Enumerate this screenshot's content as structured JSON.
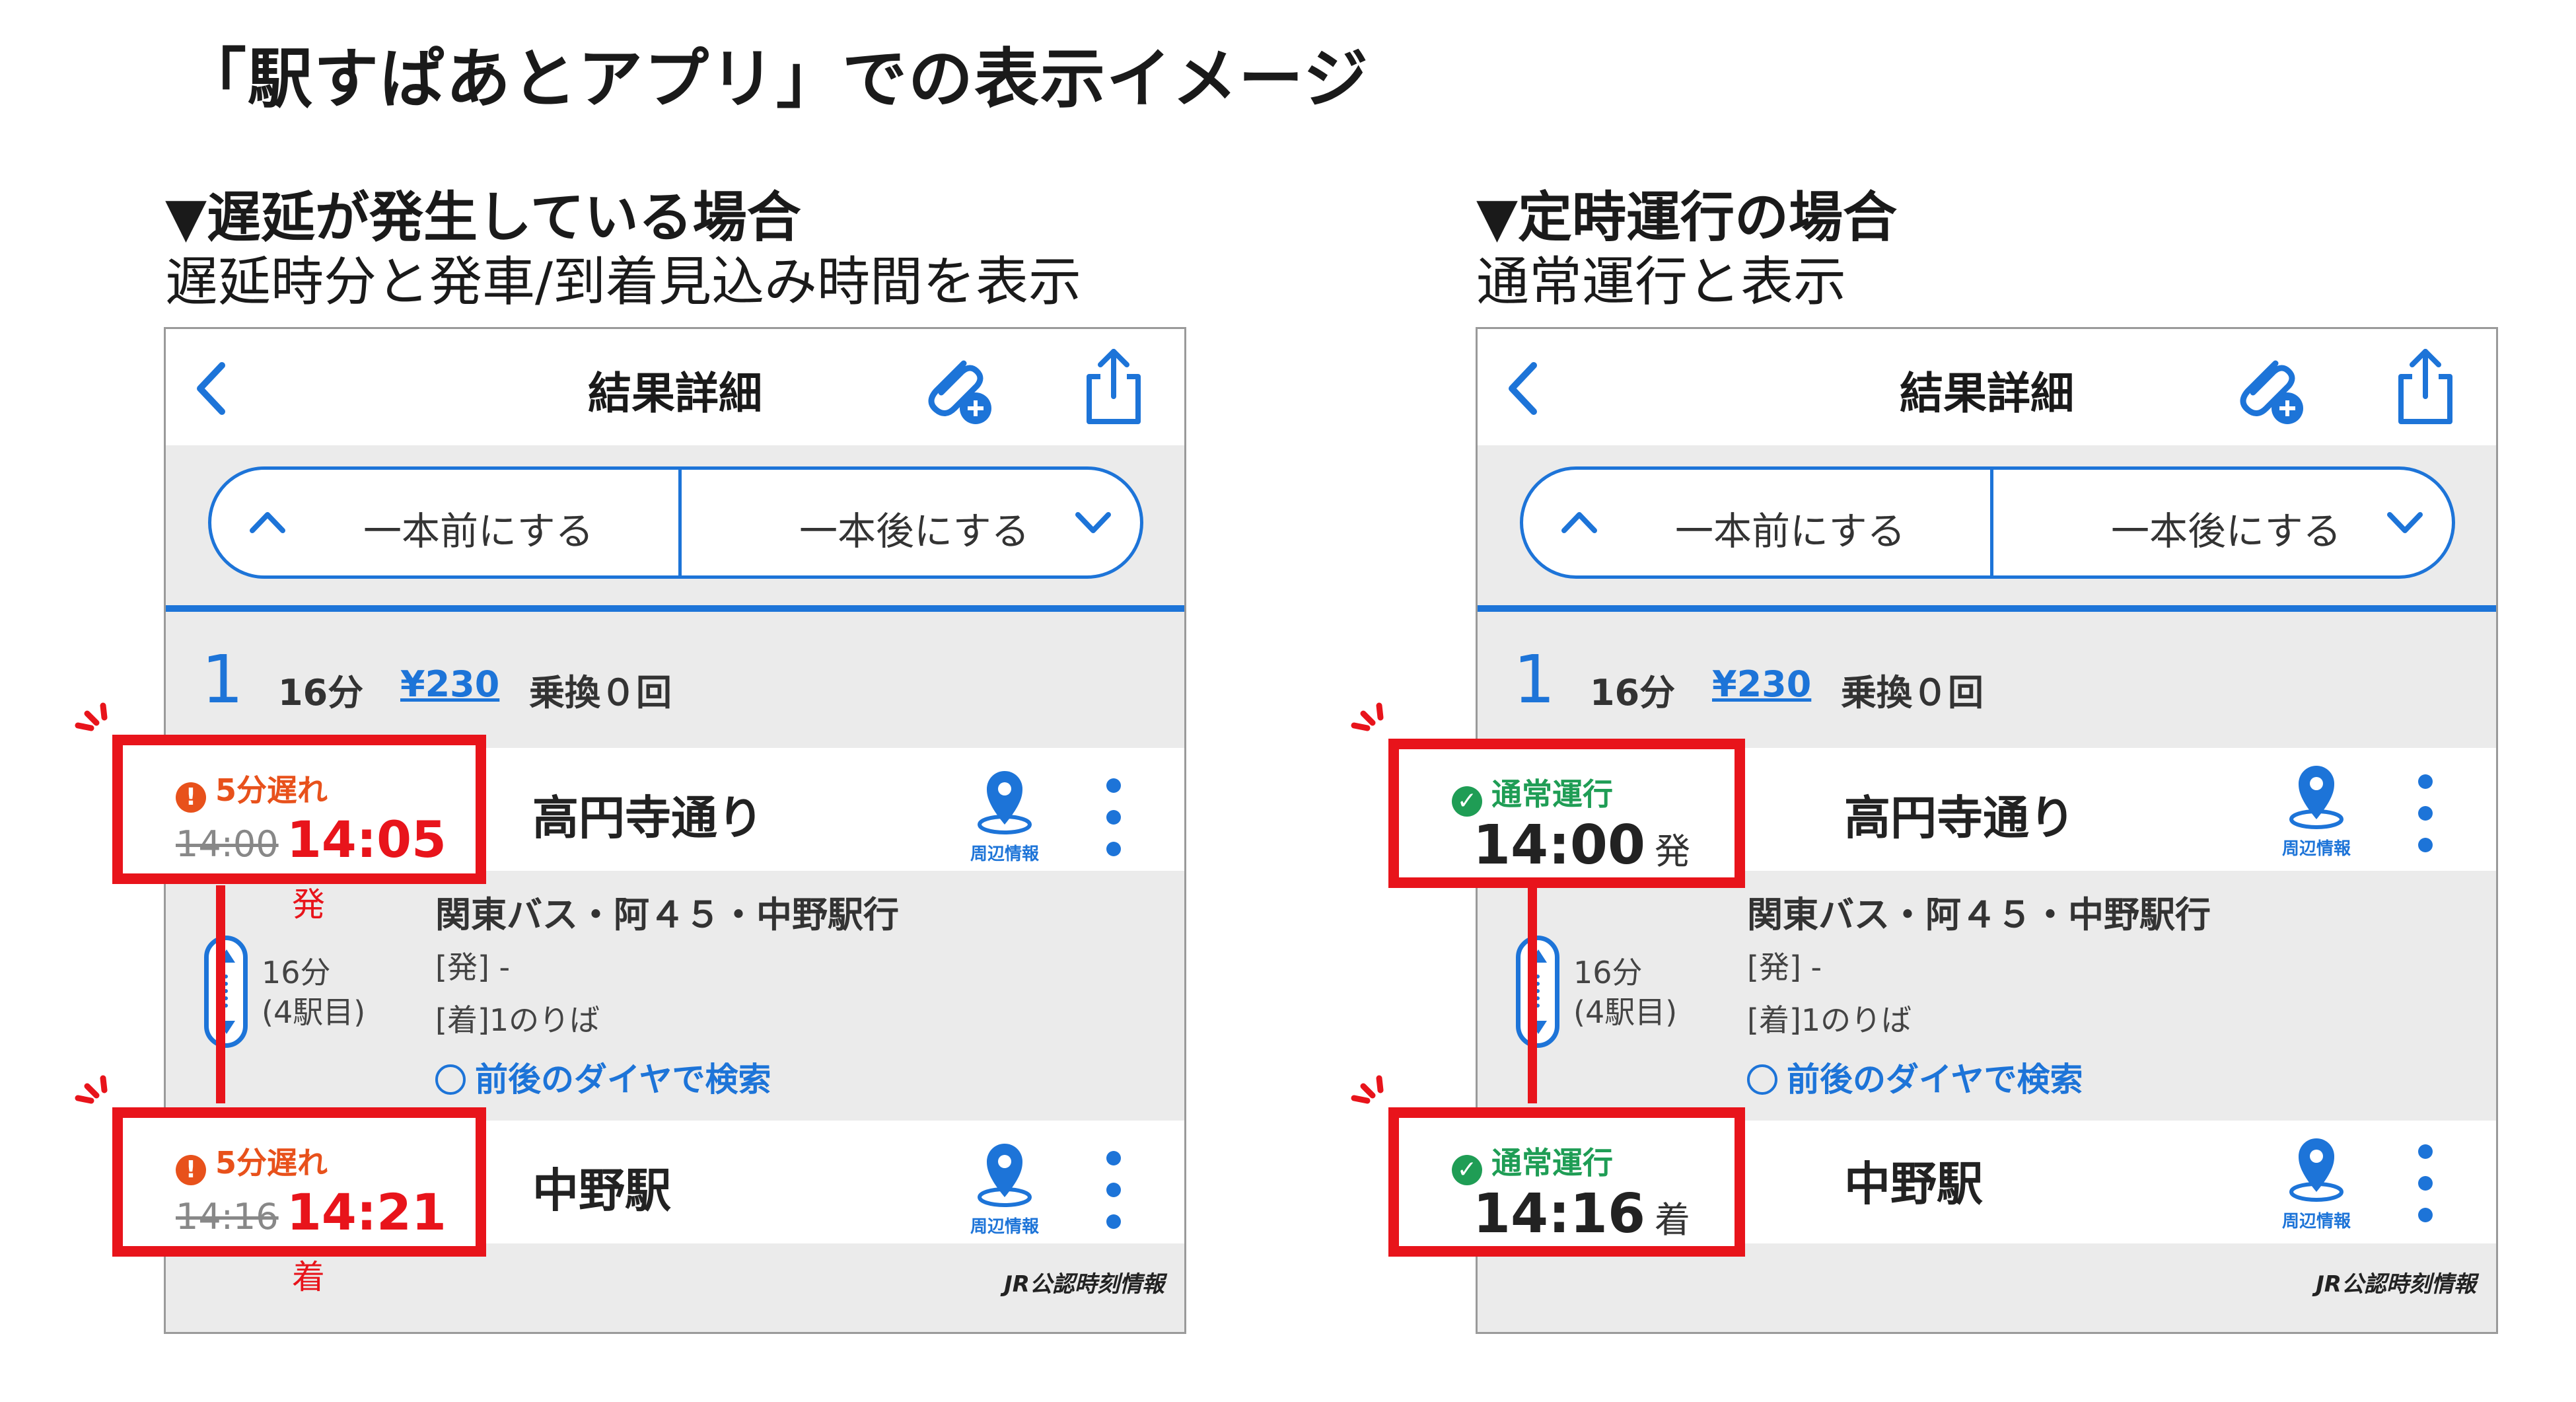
{
  "page_title": "「駅すぱあとアプリ」での表示イメージ",
  "sections": {
    "delay": {
      "heading": "▼遅延が発生している場合",
      "subheading": "遅延時分と発車/到着見込み時間を表示"
    },
    "normal": {
      "heading": "▼定時運行の場合",
      "subheading": "通常運行と表示"
    }
  },
  "screen": {
    "title": "結果詳細",
    "prev_label": "一本前にする",
    "next_label": "一本後にする",
    "route_index": "1",
    "duration": "16分",
    "fare": "¥230",
    "transfers": "乗換０回",
    "departure_station": "高円寺通り",
    "arrival_station": "中野駅",
    "area_info": "周辺情報",
    "line_name": "関東バス・阿４５・中野駅行",
    "dep_note": "[発] -",
    "arr_note": "[着]1のりば",
    "ride_duration": "16分",
    "ride_stops": "(4駅目)",
    "search_link": "前後のダイヤで検索",
    "brand": "JR公認時刻情報"
  },
  "delay_case": {
    "dep_status": "5分遅れ",
    "dep_scheduled": "14:00",
    "dep_expected": "14:05",
    "dep_suffix": "発",
    "arr_status": "5分遅れ",
    "arr_scheduled": "14:16",
    "arr_expected": "14:21",
    "arr_suffix": "着"
  },
  "normal_case": {
    "dep_status": "通常運行",
    "dep_time": "14:00",
    "dep_suffix": "発",
    "arr_status": "通常運行",
    "arr_time": "14:16",
    "arr_suffix": "着"
  },
  "colors": {
    "accent_blue": "#1d74d8",
    "highlight_red": "#e8141b",
    "delay_orange": "#e8511b",
    "normal_green": "#1f9d55"
  },
  "icons": [
    "back-chevron-icon",
    "attach-add-icon",
    "share-icon",
    "chevron-up-icon",
    "chevron-down-icon",
    "map-pin-icon",
    "more-vertical-icon",
    "clock-icon",
    "warning-icon",
    "check-icon"
  ]
}
